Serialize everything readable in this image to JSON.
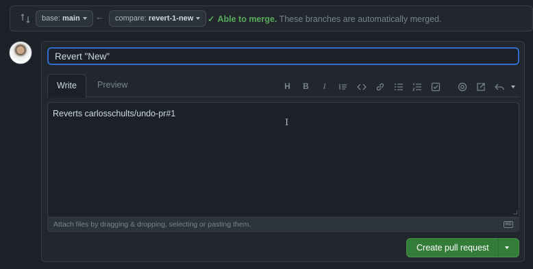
{
  "compare": {
    "base_label": "base:",
    "base_branch": "main",
    "compare_label": "compare:",
    "compare_branch": "revert-1-new",
    "status_ok": "Able to merge.",
    "status_text": " These branches are automatically merged."
  },
  "form": {
    "title_value": "Revert \"New\"",
    "tabs": {
      "write": "Write",
      "preview": "Preview"
    },
    "body": "Reverts carlosschults/undo-pr#1",
    "attach_hint": "Attach files by dragging & dropping, selecting or pasting them.",
    "markdown_badge": "MD",
    "submit_label": "Create pull request"
  },
  "toolbar": {
    "heading": "H",
    "bold": "B",
    "italic": "I"
  },
  "colors": {
    "accent": "#316dca",
    "success": "#57ab5a",
    "button": "#347d39",
    "background": "#1c2128"
  }
}
